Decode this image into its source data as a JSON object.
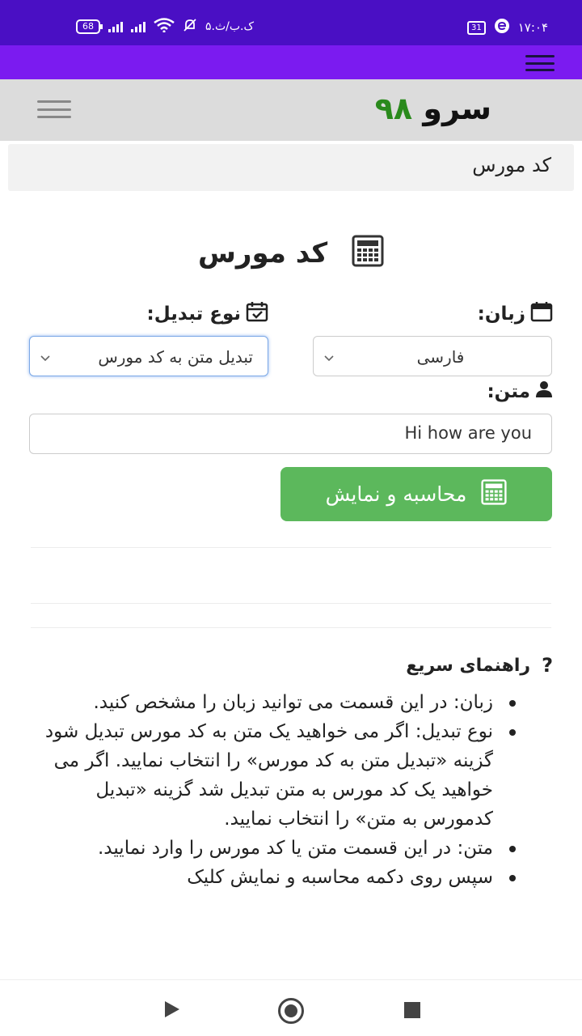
{
  "status_bar": {
    "battery": "68",
    "date_text": "۵.ک.ب/ث",
    "calendar_badge": "31",
    "time": "۱۷:۰۴"
  },
  "header": {
    "logo_word": "سرو",
    "logo_number": "۹۸",
    "logo_number_color": "#2a8a1c"
  },
  "breadcrumb": {
    "current": "کد مورس"
  },
  "page": {
    "title": "کد مورس",
    "language_label": "زبان:",
    "language_value": "فارسی",
    "conversion_label": "نوع تبدیل:",
    "conversion_value": "تبدیل متن به کد مورس",
    "text_label": "متن:",
    "text_value": "Hi how are you",
    "button_label": "محاسبه و نمایش",
    "button_color": "#5cb85c"
  },
  "help": {
    "title": "راهنمای سریع",
    "items": [
      "زبان: در این قسمت می توانید زبان را مشخص کنید.",
      "نوع تبدیل: اگر می خواهید یک متن به کد مورس تبدیل شود گزینه «تبدیل متن به کد مورس» را انتخاب نمایید. اگر می خواهید یک کد مورس به متن تبدیل شد گزینه «تبدیل کدمورس به متن» را انتخاب نمایید.",
      "متن: در این قسمت متن یا کد مورس را وارد نمایید.",
      "سپس روی دکمه محاسبه و نمایش کلیک"
    ]
  }
}
